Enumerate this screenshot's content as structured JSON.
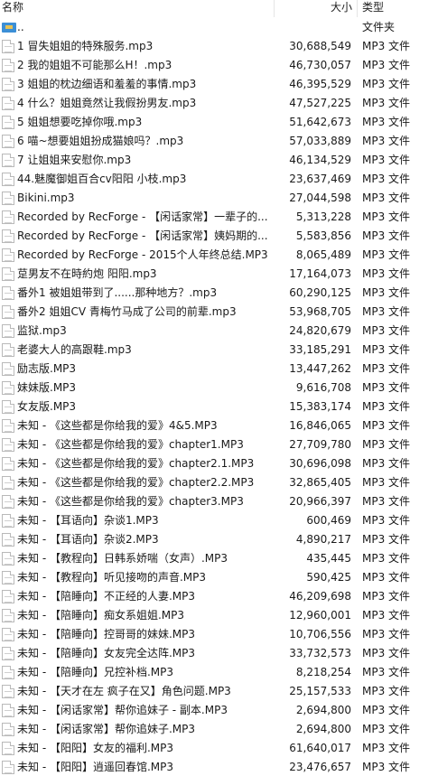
{
  "header": {
    "name_label": "名称",
    "size_label": "大小",
    "type_label": "类型",
    "sort_indicator": "^"
  },
  "rows": [
    {
      "name": "..",
      "size": "",
      "type": "文件夹",
      "icon": "parent-folder-icon"
    },
    {
      "name": "1 冒失姐姐的特殊服务.mp3",
      "size": "30,688,549",
      "type": "MP3 文件",
      "icon": "audio-file-icon"
    },
    {
      "name": "2 我的姐姐不可能那么H！.mp3",
      "size": "46,730,057",
      "type": "MP3 文件",
      "icon": "audio-file-icon"
    },
    {
      "name": "3 姐姐的枕边细语和羞羞的事情.mp3",
      "size": "46,395,529",
      "type": "MP3 文件",
      "icon": "audio-file-icon"
    },
    {
      "name": "4 什么？姐姐竟然让我假扮男友.mp3",
      "size": "47,527,225",
      "type": "MP3 文件",
      "icon": "audio-file-icon"
    },
    {
      "name": "5 姐姐想要吃掉你哦.mp3",
      "size": "51,642,673",
      "type": "MP3 文件",
      "icon": "audio-file-icon"
    },
    {
      "name": "6 喵~想要姐姐扮成猫娘吗？.mp3",
      "size": "57,033,889",
      "type": "MP3 文件",
      "icon": "audio-file-icon"
    },
    {
      "name": "7 让姐姐来安慰你.mp3",
      "size": "46,134,529",
      "type": "MP3 文件",
      "icon": "audio-file-icon"
    },
    {
      "name": "44.魅魔御姐百合cv阳阳 小枝.mp3",
      "size": "23,637,469",
      "type": "MP3 文件",
      "icon": "audio-file-icon"
    },
    {
      "name": "Bikini.mp3",
      "size": "27,044,598",
      "type": "MP3 文件",
      "icon": "audio-file-icon"
    },
    {
      "name": "Recorded by RecForge - 【闲话家常】一辈子的...",
      "size": "5,313,228",
      "type": "MP3 文件",
      "icon": "audio-file-icon"
    },
    {
      "name": "Recorded by RecForge - 【闲话家常】姨妈期的...",
      "size": "5,583,856",
      "type": "MP3 文件",
      "icon": "audio-file-icon"
    },
    {
      "name": "Recorded by RecForge - 2015个人年终总结.MP3",
      "size": "8,065,489",
      "type": "MP3 文件",
      "icon": "audio-file-icon"
    },
    {
      "name": "莡男友不在時約炮 阳阳.mp3",
      "size": "17,164,073",
      "type": "MP3 文件",
      "icon": "audio-file-icon"
    },
    {
      "name": "番外1 被姐姐带到了......那种地方？.mp3",
      "size": "60,290,125",
      "type": "MP3 文件",
      "icon": "audio-file-icon"
    },
    {
      "name": "番外2 姐姐CV 青梅竹马成了公司的前辈.mp3",
      "size": "53,968,705",
      "type": "MP3 文件",
      "icon": "audio-file-icon"
    },
    {
      "name": "监狱.mp3",
      "size": "24,820,679",
      "type": "MP3 文件",
      "icon": "audio-file-icon"
    },
    {
      "name": "老婆大人的高跟鞋.mp3",
      "size": "33,185,291",
      "type": "MP3 文件",
      "icon": "audio-file-icon"
    },
    {
      "name": "励志版.MP3",
      "size": "13,447,262",
      "type": "MP3 文件",
      "icon": "audio-file-icon"
    },
    {
      "name": "妹妹版.MP3",
      "size": "9,616,708",
      "type": "MP3 文件",
      "icon": "audio-file-icon"
    },
    {
      "name": "女友版.MP3",
      "size": "15,383,174",
      "type": "MP3 文件",
      "icon": "audio-file-icon"
    },
    {
      "name": "未知 - 《这些都是你给我的爱》4&5.MP3",
      "size": "16,846,065",
      "type": "MP3 文件",
      "icon": "audio-file-icon"
    },
    {
      "name": "未知 - 《这些都是你给我的爱》chapter1.MP3",
      "size": "27,709,780",
      "type": "MP3 文件",
      "icon": "audio-file-icon"
    },
    {
      "name": "未知 - 《这些都是你给我的爱》chapter2.1.MP3",
      "size": "30,696,098",
      "type": "MP3 文件",
      "icon": "audio-file-icon"
    },
    {
      "name": "未知 - 《这些都是你给我的爱》chapter2.2.MP3",
      "size": "32,865,405",
      "type": "MP3 文件",
      "icon": "audio-file-icon"
    },
    {
      "name": "未知 - 《这些都是你给我的爱》chapter3.MP3",
      "size": "20,966,397",
      "type": "MP3 文件",
      "icon": "audio-file-icon"
    },
    {
      "name": "未知 - 【耳语向】杂谈1.MP3",
      "size": "600,469",
      "type": "MP3 文件",
      "icon": "audio-file-icon"
    },
    {
      "name": "未知 - 【耳语向】杂谈2.MP3",
      "size": "4,890,217",
      "type": "MP3 文件",
      "icon": "audio-file-icon"
    },
    {
      "name": "未知 - 【教程向】日韩系娇喘（女声）.MP3",
      "size": "435,445",
      "type": "MP3 文件",
      "icon": "audio-file-icon"
    },
    {
      "name": "未知 - 【教程向】听见接吻的声音.MP3",
      "size": "590,425",
      "type": "MP3 文件",
      "icon": "audio-file-icon"
    },
    {
      "name": "未知 - 【陪睡向】不正经的人妻.MP3",
      "size": "46,209,698",
      "type": "MP3 文件",
      "icon": "audio-file-icon"
    },
    {
      "name": "未知 - 【陪睡向】痴女系姐姐.MP3",
      "size": "12,960,001",
      "type": "MP3 文件",
      "icon": "audio-file-icon"
    },
    {
      "name": "未知 - 【陪睡向】控哥哥的妹妹.MP3",
      "size": "10,706,556",
      "type": "MP3 文件",
      "icon": "audio-file-icon"
    },
    {
      "name": "未知 - 【陪睡向】女友完全达阵.MP3",
      "size": "33,732,573",
      "type": "MP3 文件",
      "icon": "audio-file-icon"
    },
    {
      "name": "未知 - 【陪睡向】兄控补档.MP3",
      "size": "8,218,254",
      "type": "MP3 文件",
      "icon": "audio-file-icon"
    },
    {
      "name": "未知 - 【天才在左 疯子在又】角色问题.MP3",
      "size": "25,157,533",
      "type": "MP3 文件",
      "icon": "audio-file-icon"
    },
    {
      "name": "未知 - 【闲话家常】帮你追妹子 - 副本.MP3",
      "size": "2,694,800",
      "type": "MP3 文件",
      "icon": "audio-file-icon"
    },
    {
      "name": "未知 - 【闲话家常】帮你追妹子.MP3",
      "size": "2,694,800",
      "type": "MP3 文件",
      "icon": "audio-file-icon"
    },
    {
      "name": "未知 - 【阳阳】女友的福利.MP3",
      "size": "61,640,017",
      "type": "MP3 文件",
      "icon": "audio-file-icon"
    },
    {
      "name": "未知 - 【阳阳】逍遥回春馆.MP3",
      "size": "23,476,657",
      "type": "MP3 文件",
      "icon": "audio-file-icon"
    }
  ]
}
